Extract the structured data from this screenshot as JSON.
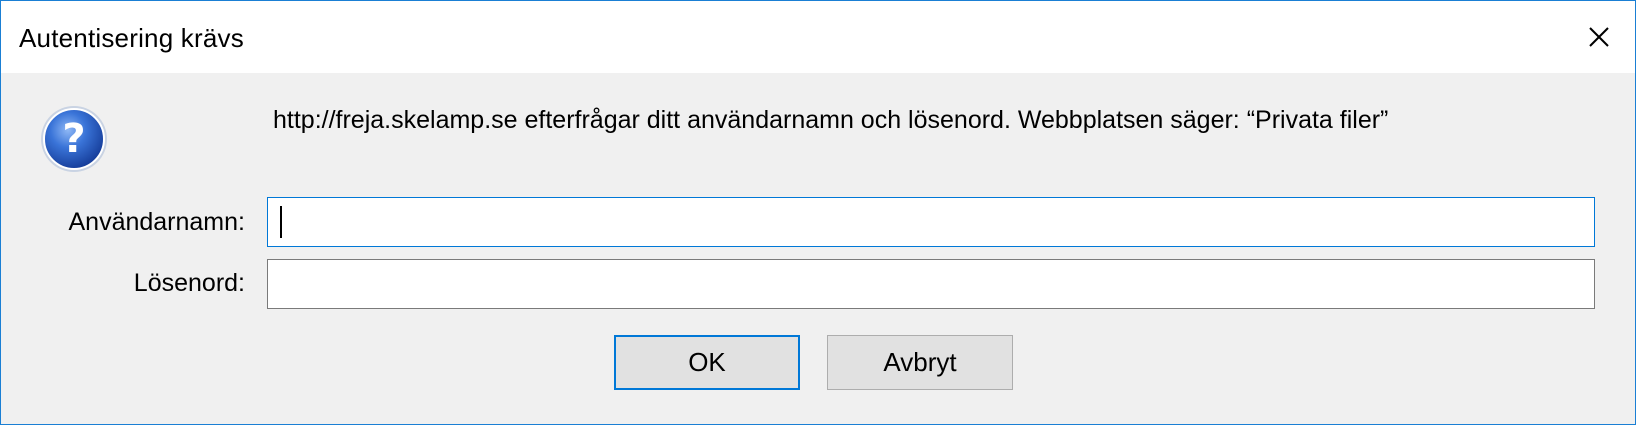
{
  "dialog": {
    "title": "Autentisering krävs",
    "close_icon": "close-icon",
    "icon": "question-icon",
    "message": "http://freja.skelamp.se efterfrågar ditt användarnamn och lösenord. Webbplatsen säger: “Privata filer”",
    "username_label": "Användarnamn:",
    "username_value": "",
    "password_label": "Lösenord:",
    "password_value": "",
    "ok_label": "OK",
    "cancel_label": "Avbryt"
  },
  "colors": {
    "accent": "#0078d7",
    "border": "#1a7fd4",
    "background": "#f0f0f0",
    "icon_blue": "#2a63c8"
  }
}
